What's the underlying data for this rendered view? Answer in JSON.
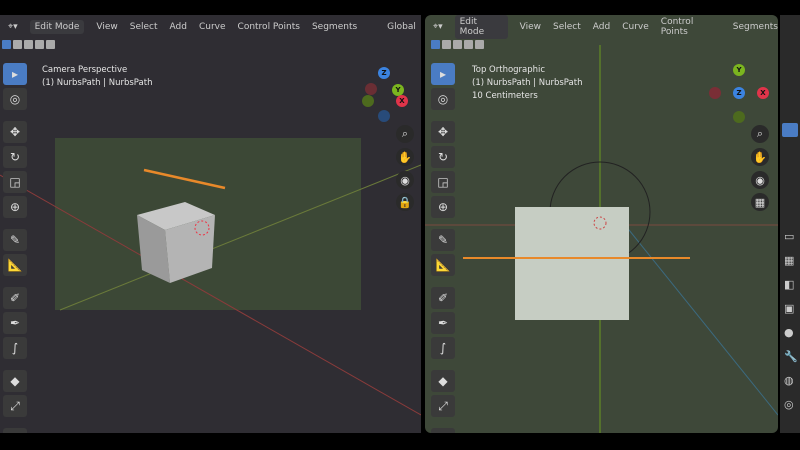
{
  "left_viewport": {
    "header": {
      "mode": "Edit Mode",
      "menus": [
        "View",
        "Select",
        "Add",
        "Curve",
        "Control Points",
        "Segments"
      ],
      "orientation": "Global"
    },
    "view_name": "Camera Perspective",
    "object_info": "(1) NurbsPath | NurbsPath"
  },
  "right_viewport": {
    "header": {
      "mode": "Edit Mode",
      "menus": [
        "View",
        "Select",
        "Add",
        "Curve",
        "Control Points",
        "Segments"
      ]
    },
    "view_name": "Top Orthographic",
    "object_info": "(1) NurbsPath | NurbsPath",
    "scale": "10 Centimeters"
  },
  "gizmo": {
    "x": "X",
    "y": "Y",
    "z": "Z"
  },
  "colors": {
    "x_axis": "#e0344a",
    "y_axis": "#7bb51f",
    "z_axis": "#3b83e0",
    "curve": "#e8892a",
    "accent": "#4a7cc4"
  }
}
